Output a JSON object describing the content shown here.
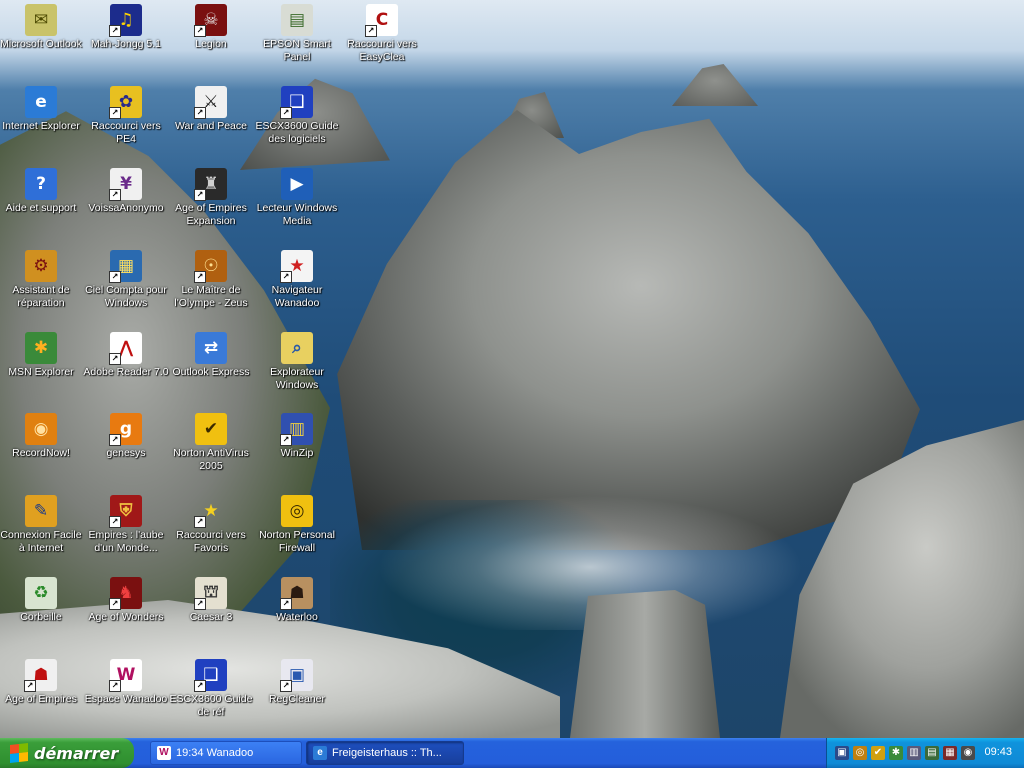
{
  "desktop": {
    "icons": [
      {
        "label": "Microsoft Outlook",
        "glyph": "✉",
        "icon": "outlook-icon",
        "bg": "#c9c36a",
        "fg": "#4b4800",
        "shortcut": false
      },
      {
        "label": "Mah-Jongg 5.1",
        "glyph": "♫",
        "icon": "mahjongg-icon",
        "bg": "#1c2c8c",
        "fg": "#ffd400",
        "shortcut": true
      },
      {
        "label": "Legion",
        "glyph": "☠",
        "icon": "legion-icon",
        "bg": "#7a1010",
        "fg": "#e8e8e8",
        "shortcut": true
      },
      {
        "label": "EPSON Smart Panel",
        "glyph": "▤",
        "icon": "scanner-icon",
        "bg": "#d8dcd4",
        "fg": "#3a6a2a",
        "shortcut": false
      },
      {
        "label": "Raccourci vers EasyClea",
        "glyph": "C",
        "icon": "easyclea-icon",
        "bg": "#ffffff",
        "fg": "#b01010",
        "shortcut": true
      },
      {
        "label": "Internet Explorer",
        "glyph": "e",
        "icon": "internet-explorer-icon",
        "bg": "#2b7bd6",
        "fg": "#ffffff",
        "shortcut": false
      },
      {
        "label": "Raccourci vers PE4",
        "glyph": "✿",
        "icon": "pe4-icon",
        "bg": "#e8c020",
        "fg": "#2a2a8a",
        "shortcut": true
      },
      {
        "label": "War and Peace",
        "glyph": "⚔",
        "icon": "war-and-peace-icon",
        "bg": "#f0f0f0",
        "fg": "#222222",
        "shortcut": true
      },
      {
        "label": "ESCX3600 Guide des logiciels",
        "glyph": "❑",
        "icon": "epson-guide-icon",
        "bg": "#2040c0",
        "fg": "#ffffff",
        "shortcut": true
      },
      {
        "label": "Aide et support",
        "glyph": "?",
        "icon": "help-icon",
        "bg": "#2f6fd8",
        "fg": "#ffffff",
        "shortcut": false
      },
      {
        "label": "VoissaAnonymo",
        "glyph": "¥",
        "icon": "voissa-icon",
        "bg": "#f0f0f0",
        "fg": "#6a2a8a",
        "shortcut": true
      },
      {
        "label": "Age of Empires Expansion",
        "glyph": "♜",
        "icon": "aoe-expansion-icon",
        "bg": "#2a2a2a",
        "fg": "#d0d0d0",
        "shortcut": true
      },
      {
        "label": "Lecteur Windows Media",
        "glyph": "▶",
        "icon": "windows-media-icon",
        "bg": "#1f5fb8",
        "fg": "#ffffff",
        "shortcut": false
      },
      {
        "label": "Assistant de réparation",
        "glyph": "⚙",
        "icon": "repair-assistant-icon",
        "bg": "#d09020",
        "fg": "#7a1010",
        "shortcut": false
      },
      {
        "label": "Ciel Compta pour Windows",
        "glyph": "▦",
        "icon": "ciel-compta-icon",
        "bg": "#2a6ab0",
        "fg": "#ffe060",
        "shortcut": true
      },
      {
        "label": "Le Maître de l'Olympe - Zeus",
        "glyph": "☉",
        "icon": "zeus-icon",
        "bg": "#b06010",
        "fg": "#ffe090",
        "shortcut": true
      },
      {
        "label": "Navigateur Wanadoo",
        "glyph": "★",
        "icon": "wanadoo-navigator-icon",
        "bg": "#f4f4f4",
        "fg": "#d02020",
        "shortcut": true
      },
      {
        "label": "MSN Explorer",
        "glyph": "✱",
        "icon": "msn-explorer-icon",
        "bg": "#3a8a3a",
        "fg": "#ffb020",
        "shortcut": false
      },
      {
        "label": "Adobe Reader 7.0",
        "glyph": "⋀",
        "icon": "adobe-reader-icon",
        "bg": "#ffffff",
        "fg": "#c01010",
        "shortcut": true
      },
      {
        "label": "Outlook Express",
        "glyph": "⇄",
        "icon": "outlook-express-icon",
        "bg": "#3a7ad8",
        "fg": "#ffffff",
        "shortcut": false
      },
      {
        "label": "Explorateur Windows",
        "glyph": "⌕",
        "icon": "windows-explorer-icon",
        "bg": "#e8d060",
        "fg": "#2a5aa8",
        "shortcut": false
      },
      {
        "label": "RecordNow!",
        "glyph": "◉",
        "icon": "recordnow-icon",
        "bg": "#e08010",
        "fg": "#ffe0a0",
        "shortcut": false
      },
      {
        "label": "genesys",
        "glyph": "g",
        "icon": "genesys-icon",
        "bg": "#e87a10",
        "fg": "#ffffff",
        "shortcut": true
      },
      {
        "label": "Norton AntiVirus 2005",
        "glyph": "✔",
        "icon": "norton-antivirus-icon",
        "bg": "#f0c010",
        "fg": "#3a2a00",
        "shortcut": false
      },
      {
        "label": "WinZip",
        "glyph": "▥",
        "icon": "winzip-icon",
        "bg": "#3050b0",
        "fg": "#f0d040",
        "shortcut": true
      },
      {
        "label": "Connexion Facile à Internet",
        "glyph": "✎",
        "icon": "easy-connect-icon",
        "bg": "#e0a020",
        "fg": "#1a3a8a",
        "shortcut": false
      },
      {
        "label": "Empires : l'aube d'un Monde...",
        "glyph": "⛨",
        "icon": "empires-icon",
        "bg": "#a01818",
        "fg": "#f0c040",
        "shortcut": true
      },
      {
        "label": "Raccourci vers Favoris",
        "glyph": "★",
        "icon": "favorites-icon",
        "bg": "rgba(0,0,0,0)",
        "fg": "#f4d020",
        "shortcut": true
      },
      {
        "label": "Norton Personal Firewall",
        "glyph": "◎",
        "icon": "norton-firewall-icon",
        "bg": "#f0c010",
        "fg": "#3a2a00",
        "shortcut": false
      },
      {
        "label": "Corbeille",
        "glyph": "♻",
        "icon": "recycle-bin-icon",
        "bg": "#d8e4d0",
        "fg": "#2a8a2a",
        "shortcut": false
      },
      {
        "label": "Age of Wonders",
        "glyph": "♞",
        "icon": "age-of-wonders-icon",
        "bg": "#7a1010",
        "fg": "#f04040",
        "shortcut": true
      },
      {
        "label": "Caesar 3",
        "glyph": "⛫",
        "icon": "caesar3-icon",
        "bg": "#e4e0d0",
        "fg": "#3a3a3a",
        "shortcut": true
      },
      {
        "label": "Waterloo",
        "glyph": "☗",
        "icon": "waterloo-icon",
        "bg": "#b89060",
        "fg": "#2a1a10",
        "shortcut": true
      },
      {
        "label": "Age of Empires",
        "glyph": "☗",
        "icon": "age-of-empires-icon",
        "bg": "#f0f0f0",
        "fg": "#c01010",
        "shortcut": true
      },
      {
        "label": "Espace Wanadoo",
        "glyph": "W",
        "icon": "espace-wanadoo-icon",
        "bg": "#ffffff",
        "fg": "#b01060",
        "shortcut": true
      },
      {
        "label": "ESCX3600 Guide de réf",
        "glyph": "❑",
        "icon": "epson-ref-guide-icon",
        "bg": "#2040c0",
        "fg": "#ffffff",
        "shortcut": true
      },
      {
        "label": "RegCleaner",
        "glyph": "▣",
        "icon": "regcleaner-icon",
        "bg": "#e8e8f0",
        "fg": "#2a5ab0",
        "shortcut": true
      }
    ]
  },
  "taskbar": {
    "start_label": "démarrer",
    "tasks": [
      {
        "label": "19:34 Wanadoo",
        "glyph": "W",
        "icon": "wanadoo-task-icon",
        "bg": "#ffffff",
        "fg": "#b01060"
      },
      {
        "label": "Freigeisterhaus :: Th...",
        "glyph": "e",
        "icon": "internet-explorer-task-icon",
        "bg": "#2b7bd6",
        "fg": "#ffffff"
      }
    ],
    "tray_icons": [
      {
        "glyph": "▣",
        "icon": "network-tray-icon",
        "bg": "#2a4a8a"
      },
      {
        "glyph": "◎",
        "icon": "globe-tray-icon",
        "bg": "#c08010"
      },
      {
        "glyph": "✔",
        "icon": "norton-tray-icon",
        "bg": "#d0a010"
      },
      {
        "glyph": "✱",
        "icon": "msn-tray-icon",
        "bg": "#3a8a3a"
      },
      {
        "glyph": "▥",
        "icon": "printer-tray-icon",
        "bg": "#5a5a7a"
      },
      {
        "glyph": "▤",
        "icon": "scanner-tray-icon",
        "bg": "#3a6a3a"
      },
      {
        "glyph": "▦",
        "icon": "display-tray-icon",
        "bg": "#7a2a2a"
      },
      {
        "glyph": "◉",
        "icon": "volume-tray-icon",
        "bg": "#4a4a4a"
      }
    ],
    "clock": "09:43"
  }
}
